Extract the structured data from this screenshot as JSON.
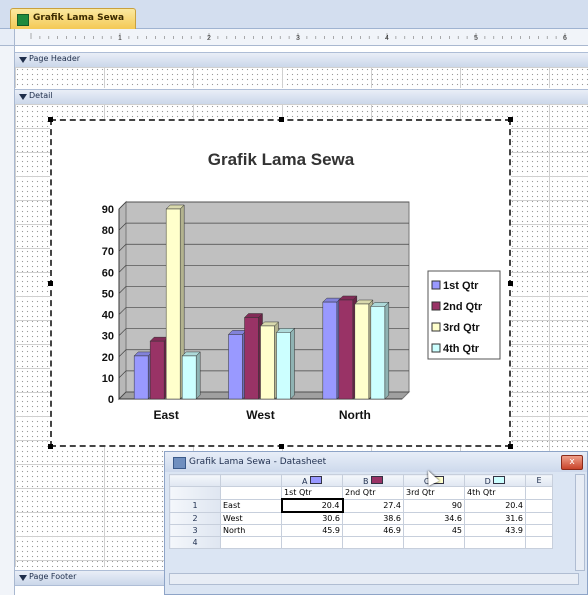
{
  "tab": {
    "label": "Grafik Lama Sewa"
  },
  "ruler": {
    "marks": [
      "1",
      "2",
      "3",
      "4",
      "5",
      "6"
    ]
  },
  "bands": {
    "page_header": "Page Header",
    "detail": "Detail",
    "page_footer": "Page Footer"
  },
  "chart_data": {
    "type": "bar",
    "title": "Grafik Lama Sewa",
    "categories": [
      "East",
      "West",
      "North"
    ],
    "series": [
      {
        "name": "1st Qtr",
        "values": [
          20.4,
          30.6,
          45.9
        ],
        "color": "#9999ff"
      },
      {
        "name": "2nd Qtr",
        "values": [
          27.4,
          38.6,
          46.9
        ],
        "color": "#993366"
      },
      {
        "name": "3rd Qtr",
        "values": [
          90,
          34.6,
          45
        ],
        "color": "#ffffcc"
      },
      {
        "name": "4th Qtr",
        "values": [
          20.4,
          31.6,
          43.9
        ],
        "color": "#ccffff"
      }
    ],
    "ylim": [
      0,
      90
    ],
    "yticks": [
      "0",
      "10",
      "20",
      "30",
      "40",
      "50",
      "60",
      "70",
      "80",
      "90"
    ],
    "grid": true,
    "legend": "right"
  },
  "datasheet": {
    "title": "Grafik Lama Sewa - Datasheet",
    "columns": [
      "A",
      "B",
      "C",
      "D",
      "E"
    ],
    "header_row": [
      "1st Qtr",
      "2nd Qtr",
      "3rd Qtr",
      "4th Qtr"
    ],
    "rows": [
      {
        "num": "1",
        "label": "East",
        "values": [
          "20.4",
          "27.4",
          "90",
          "20.4"
        ]
      },
      {
        "num": "2",
        "label": "West",
        "values": [
          "30.6",
          "38.6",
          "34.6",
          "31.6"
        ]
      },
      {
        "num": "3",
        "label": "North",
        "values": [
          "45.9",
          "46.9",
          "45",
          "43.9"
        ]
      },
      {
        "num": "4",
        "label": "",
        "values": [
          "",
          "",
          "",
          ""
        ]
      }
    ],
    "close": "x"
  }
}
